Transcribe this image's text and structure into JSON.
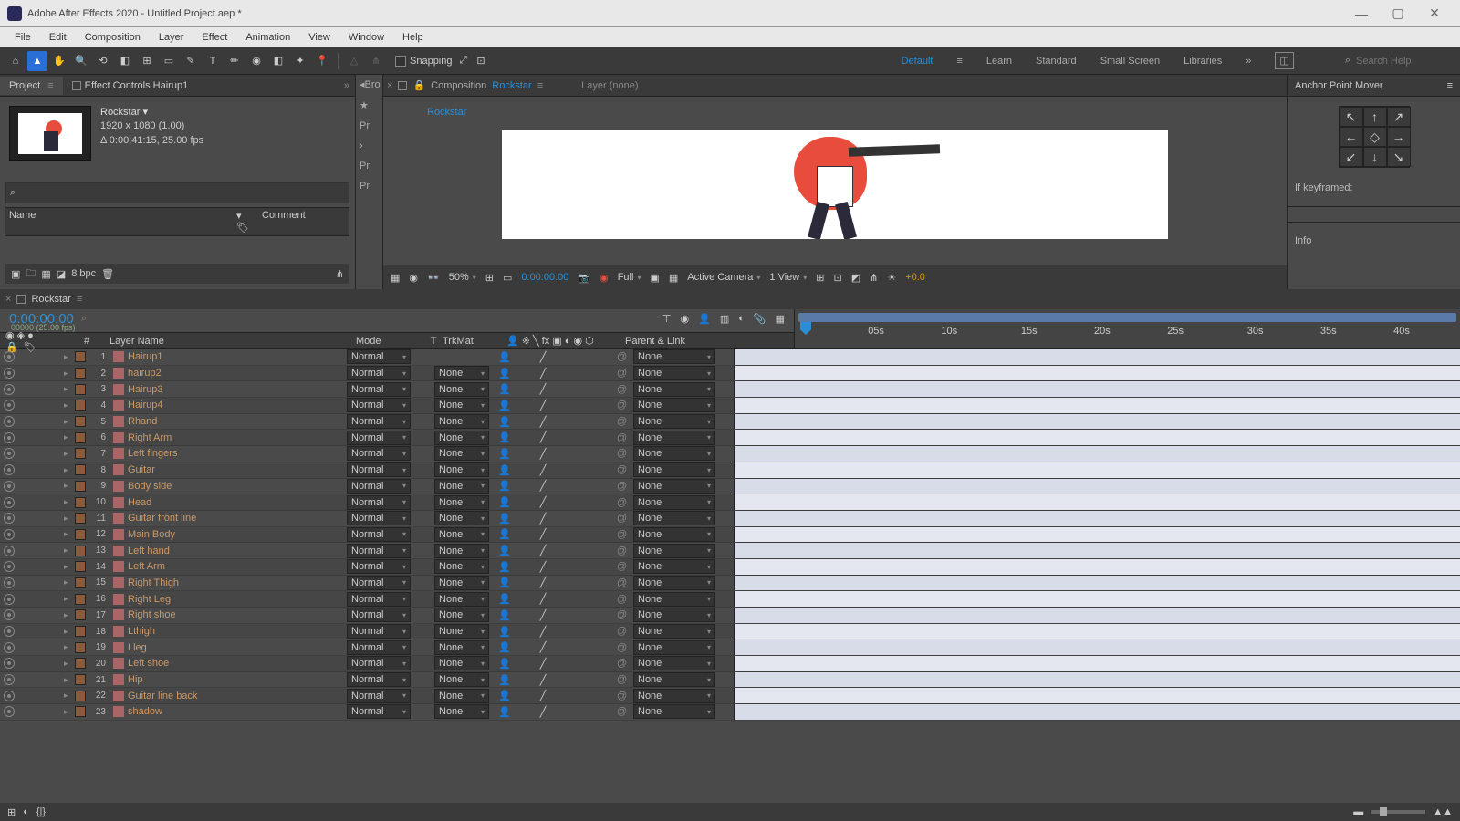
{
  "titlebar": {
    "title": "Adobe After Effects 2020 - Untitled Project.aep *"
  },
  "menu": [
    "File",
    "Edit",
    "Composition",
    "Layer",
    "Effect",
    "Animation",
    "View",
    "Window",
    "Help"
  ],
  "toolbar": {
    "snapping": "Snapping"
  },
  "workspaces": [
    "Default",
    "Learn",
    "Standard",
    "Small Screen",
    "Libraries"
  ],
  "search_placeholder": "Search Help",
  "project": {
    "tab": "Project",
    "fx_tab": "Effect Controls Hairup1",
    "comp_name": "Rockstar ▾",
    "dims": "1920 x 1080 (1.00)",
    "dur": "Δ 0:00:41:15, 25.00 fps",
    "col_name": "Name",
    "col_comment": "Comment",
    "bpc": "8 bpc"
  },
  "bro_items": [
    "◂Bro",
    "★",
    "Pr",
    "›",
    "Pr",
    "",
    "Pr"
  ],
  "comp": {
    "tab_prefix": "Composition",
    "tab_name": "Rockstar",
    "layer_tab": "Layer (none)",
    "flow": "Rockstar",
    "zoom": "50%",
    "time": "0:00:00:00",
    "res": "Full",
    "camera": "Active Camera",
    "view": "1 View",
    "exposure": "+0.0"
  },
  "anchor": {
    "title": "Anchor Point Mover",
    "arrows": [
      "↖",
      "↑",
      "↗",
      "←",
      "◇",
      "→",
      "↙",
      "↓",
      "↘"
    ],
    "kf": "If keyframed:",
    "info": "Info"
  },
  "timeline": {
    "tab": "Rockstar",
    "timecode": "0:00:00:00",
    "sub": "00000 (25.00 fps)",
    "cols": {
      "idx": "#",
      "name": "Layer Name",
      "mode": "Mode",
      "t": "T",
      "trk": "TrkMat",
      "parent": "Parent & Link"
    },
    "ticks": [
      "05s",
      "10s",
      "15s",
      "20s",
      "25s",
      "30s",
      "35s",
      "40s"
    ]
  },
  "layers": [
    {
      "n": 1,
      "name": "Hairup1",
      "mode": "Normal",
      "trk": "",
      "parent": "None"
    },
    {
      "n": 2,
      "name": "hairup2",
      "mode": "Normal",
      "trk": "None",
      "parent": "None"
    },
    {
      "n": 3,
      "name": "Hairup3",
      "mode": "Normal",
      "trk": "None",
      "parent": "None"
    },
    {
      "n": 4,
      "name": "Hairup4",
      "mode": "Normal",
      "trk": "None",
      "parent": "None"
    },
    {
      "n": 5,
      "name": "Rhand",
      "mode": "Normal",
      "trk": "None",
      "parent": "None"
    },
    {
      "n": 6,
      "name": "Right Arm",
      "mode": "Normal",
      "trk": "None",
      "parent": "None"
    },
    {
      "n": 7,
      "name": "Left fingers",
      "mode": "Normal",
      "trk": "None",
      "parent": "None"
    },
    {
      "n": 8,
      "name": "Guitar",
      "mode": "Normal",
      "trk": "None",
      "parent": "None"
    },
    {
      "n": 9,
      "name": "Body side",
      "mode": "Normal",
      "trk": "None",
      "parent": "None"
    },
    {
      "n": 10,
      "name": "Head",
      "mode": "Normal",
      "trk": "None",
      "parent": "None"
    },
    {
      "n": 11,
      "name": "Guitar front line",
      "mode": "Normal",
      "trk": "None",
      "parent": "None"
    },
    {
      "n": 12,
      "name": "Main Body",
      "mode": "Normal",
      "trk": "None",
      "parent": "None"
    },
    {
      "n": 13,
      "name": "Left hand",
      "mode": "Normal",
      "trk": "None",
      "parent": "None"
    },
    {
      "n": 14,
      "name": "Left Arm",
      "mode": "Normal",
      "trk": "None",
      "parent": "None"
    },
    {
      "n": 15,
      "name": "Right Thigh",
      "mode": "Normal",
      "trk": "None",
      "parent": "None"
    },
    {
      "n": 16,
      "name": "Right Leg",
      "mode": "Normal",
      "trk": "None",
      "parent": "None"
    },
    {
      "n": 17,
      "name": "Right shoe",
      "mode": "Normal",
      "trk": "None",
      "parent": "None"
    },
    {
      "n": 18,
      "name": "Lthigh",
      "mode": "Normal",
      "trk": "None",
      "parent": "None"
    },
    {
      "n": 19,
      "name": "Lleg",
      "mode": "Normal",
      "trk": "None",
      "parent": "None"
    },
    {
      "n": 20,
      "name": "Left shoe",
      "mode": "Normal",
      "trk": "None",
      "parent": "None"
    },
    {
      "n": 21,
      "name": "Hip",
      "mode": "Normal",
      "trk": "None",
      "parent": "None"
    },
    {
      "n": 22,
      "name": "Guitar line back",
      "mode": "Normal",
      "trk": "None",
      "parent": "None"
    },
    {
      "n": 23,
      "name": "shadow",
      "mode": "Normal",
      "trk": "None",
      "parent": "None"
    }
  ]
}
